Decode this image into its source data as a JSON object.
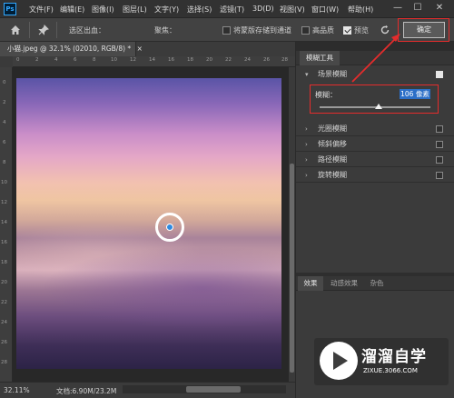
{
  "menu": {
    "items": [
      "文件(F)",
      "编辑(E)",
      "图像(I)",
      "图层(L)",
      "文字(Y)",
      "选择(S)",
      "滤镜(T)",
      "3D(D)",
      "视图(V)",
      "窗口(W)",
      "帮助(H)"
    ],
    "logo": "Ps",
    "window_controls": [
      "—",
      "☐",
      "✕"
    ]
  },
  "options": {
    "selection_label": "选区出血：",
    "focus_label": "聚焦：",
    "save_mask_label": "将蒙版存储到通道",
    "high_quality_label": "高品质",
    "preview_label": "预览",
    "ok_label": "确定",
    "preview_checked": true
  },
  "document": {
    "tab_title": "小猫.jpeg @ 32.1% (02010, RGB/8) *",
    "tab_close": "×",
    "zoom": "32.11%",
    "doc_size": "文档:6.90M/23.2M",
    "ruler_h": [
      "0",
      "2",
      "4",
      "6",
      "8",
      "10",
      "12",
      "14",
      "16",
      "18",
      "20",
      "22",
      "24",
      "26",
      "28"
    ],
    "ruler_v": [
      "0",
      "2",
      "4",
      "6",
      "8",
      "10",
      "12",
      "14",
      "16",
      "18",
      "20",
      "22",
      "24",
      "26",
      "28"
    ]
  },
  "panel": {
    "title": "模糊工具",
    "field_blur_label": "场景模糊",
    "blur_label": "模糊：",
    "blur_value": "106 像素",
    "blur_fraction": 0.5,
    "items": [
      {
        "label": "光圈模糊",
        "checked": false
      },
      {
        "label": "倾斜偏移",
        "checked": false
      },
      {
        "label": "路径模糊",
        "checked": false
      },
      {
        "label": "旋转模糊",
        "checked": false
      }
    ],
    "bottom_tabs": [
      "效果",
      "动感效果",
      "杂色"
    ]
  },
  "watermark": {
    "title": "溜溜自学",
    "url": "ZIXUE.3066.COM"
  },
  "icons": {
    "home": "home-icon",
    "pin": "pin-icon",
    "reset": "reset-icon"
  },
  "colors": {
    "highlight": "#e52c2c",
    "selection": "#2c6fc7"
  }
}
